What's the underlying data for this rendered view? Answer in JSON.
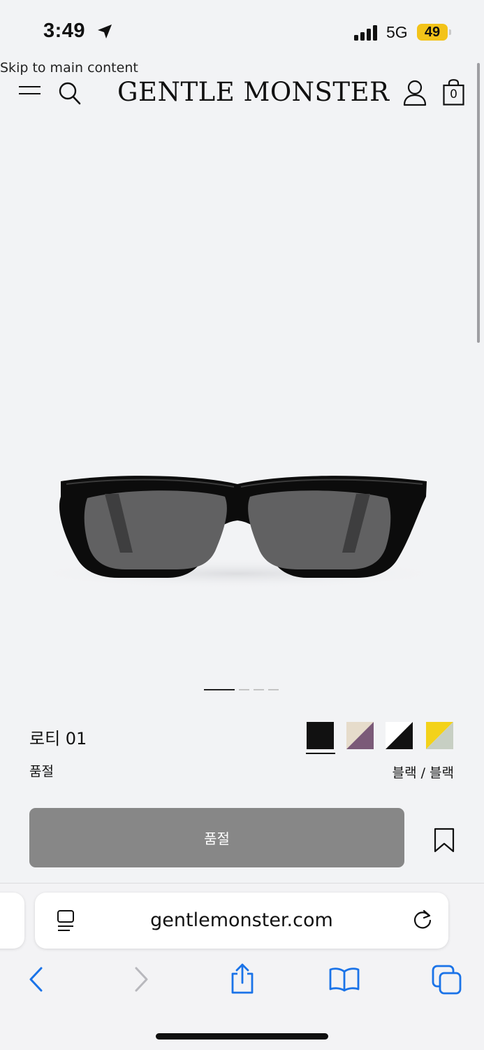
{
  "status_bar": {
    "time": "3:49",
    "network": "5G",
    "battery": "49"
  },
  "skip_link": "Skip to main content",
  "header": {
    "brand": "GENTLE MONSTER",
    "cart_count": "0"
  },
  "gallery": {
    "pages": 4,
    "active_page": 1
  },
  "product": {
    "name": "로티 01",
    "status": "품절",
    "color_name": "블랙 / 블랙",
    "swatches": [
      {
        "name": "black",
        "selected": true
      },
      {
        "name": "beige-purple",
        "selected": false
      },
      {
        "name": "white-black",
        "selected": false
      },
      {
        "name": "yellow-green",
        "selected": false
      }
    ],
    "button_label": "품절"
  },
  "browser": {
    "url": "gentlemonster.com"
  },
  "colors": {
    "button_gray": "#878787",
    "battery_yellow": "#f3c319",
    "safari_blue": "#1a73e8"
  }
}
